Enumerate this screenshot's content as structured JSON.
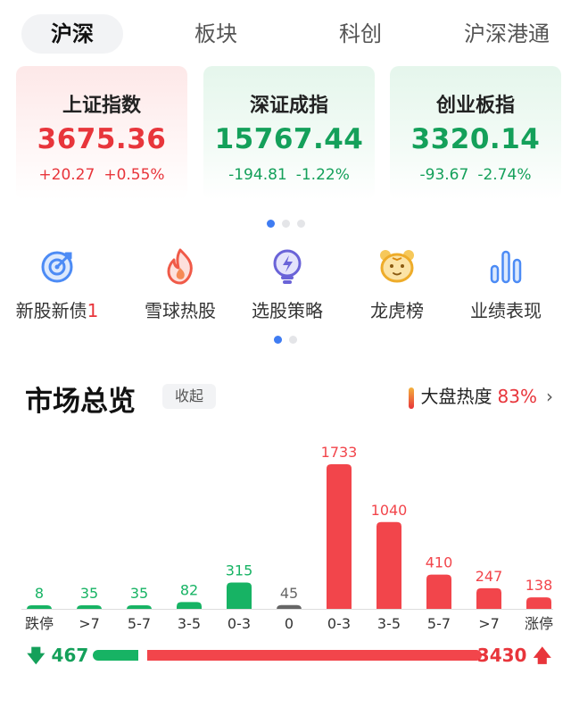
{
  "tabs": [
    "沪深",
    "板块",
    "科创",
    "沪深港通"
  ],
  "active_tab": 0,
  "indices": [
    {
      "name": "上证指数",
      "value": "3675.36",
      "change": "+20.27",
      "pct": "+0.55%",
      "trend": "up"
    },
    {
      "name": "深证成指",
      "value": "15767.44",
      "change": "-194.81",
      "pct": "-1.22%",
      "trend": "down"
    },
    {
      "name": "创业板指",
      "value": "3320.14",
      "change": "-93.67",
      "pct": "-2.74%",
      "trend": "down"
    }
  ],
  "shortcuts": [
    {
      "label": "新股新债",
      "badge": "1",
      "icon": "target-icon"
    },
    {
      "label": "雪球热股",
      "badge": "",
      "icon": "fire-icon"
    },
    {
      "label": "选股策略",
      "badge": "",
      "icon": "lightbulb-icon"
    },
    {
      "label": "龙虎榜",
      "badge": "",
      "icon": "tiger-icon"
    },
    {
      "label": "业绩表现",
      "badge": "",
      "icon": "bar-chart-icon"
    }
  ],
  "market": {
    "title": "市场总览",
    "collapse_label": "收起",
    "heat_label": "大盘热度",
    "heat_value": "83%",
    "down_total": "467",
    "up_total": "3430"
  },
  "chart_data": {
    "type": "bar",
    "categories": [
      "跌停",
      ">7",
      "5-7",
      "3-5",
      "0-3",
      "0",
      "0-3",
      "3-5",
      "5-7",
      ">7",
      "涨停"
    ],
    "values": [
      8,
      35,
      35,
      82,
      315,
      45,
      1733,
      1040,
      410,
      247,
      138
    ],
    "groups": [
      "down",
      "down",
      "down",
      "down",
      "down",
      "flat",
      "up",
      "up",
      "up",
      "up",
      "up"
    ]
  },
  "colors": {
    "up": "#f2454b",
    "down": "#17b364",
    "flat": "#666666",
    "accent": "#3f7cf2"
  }
}
